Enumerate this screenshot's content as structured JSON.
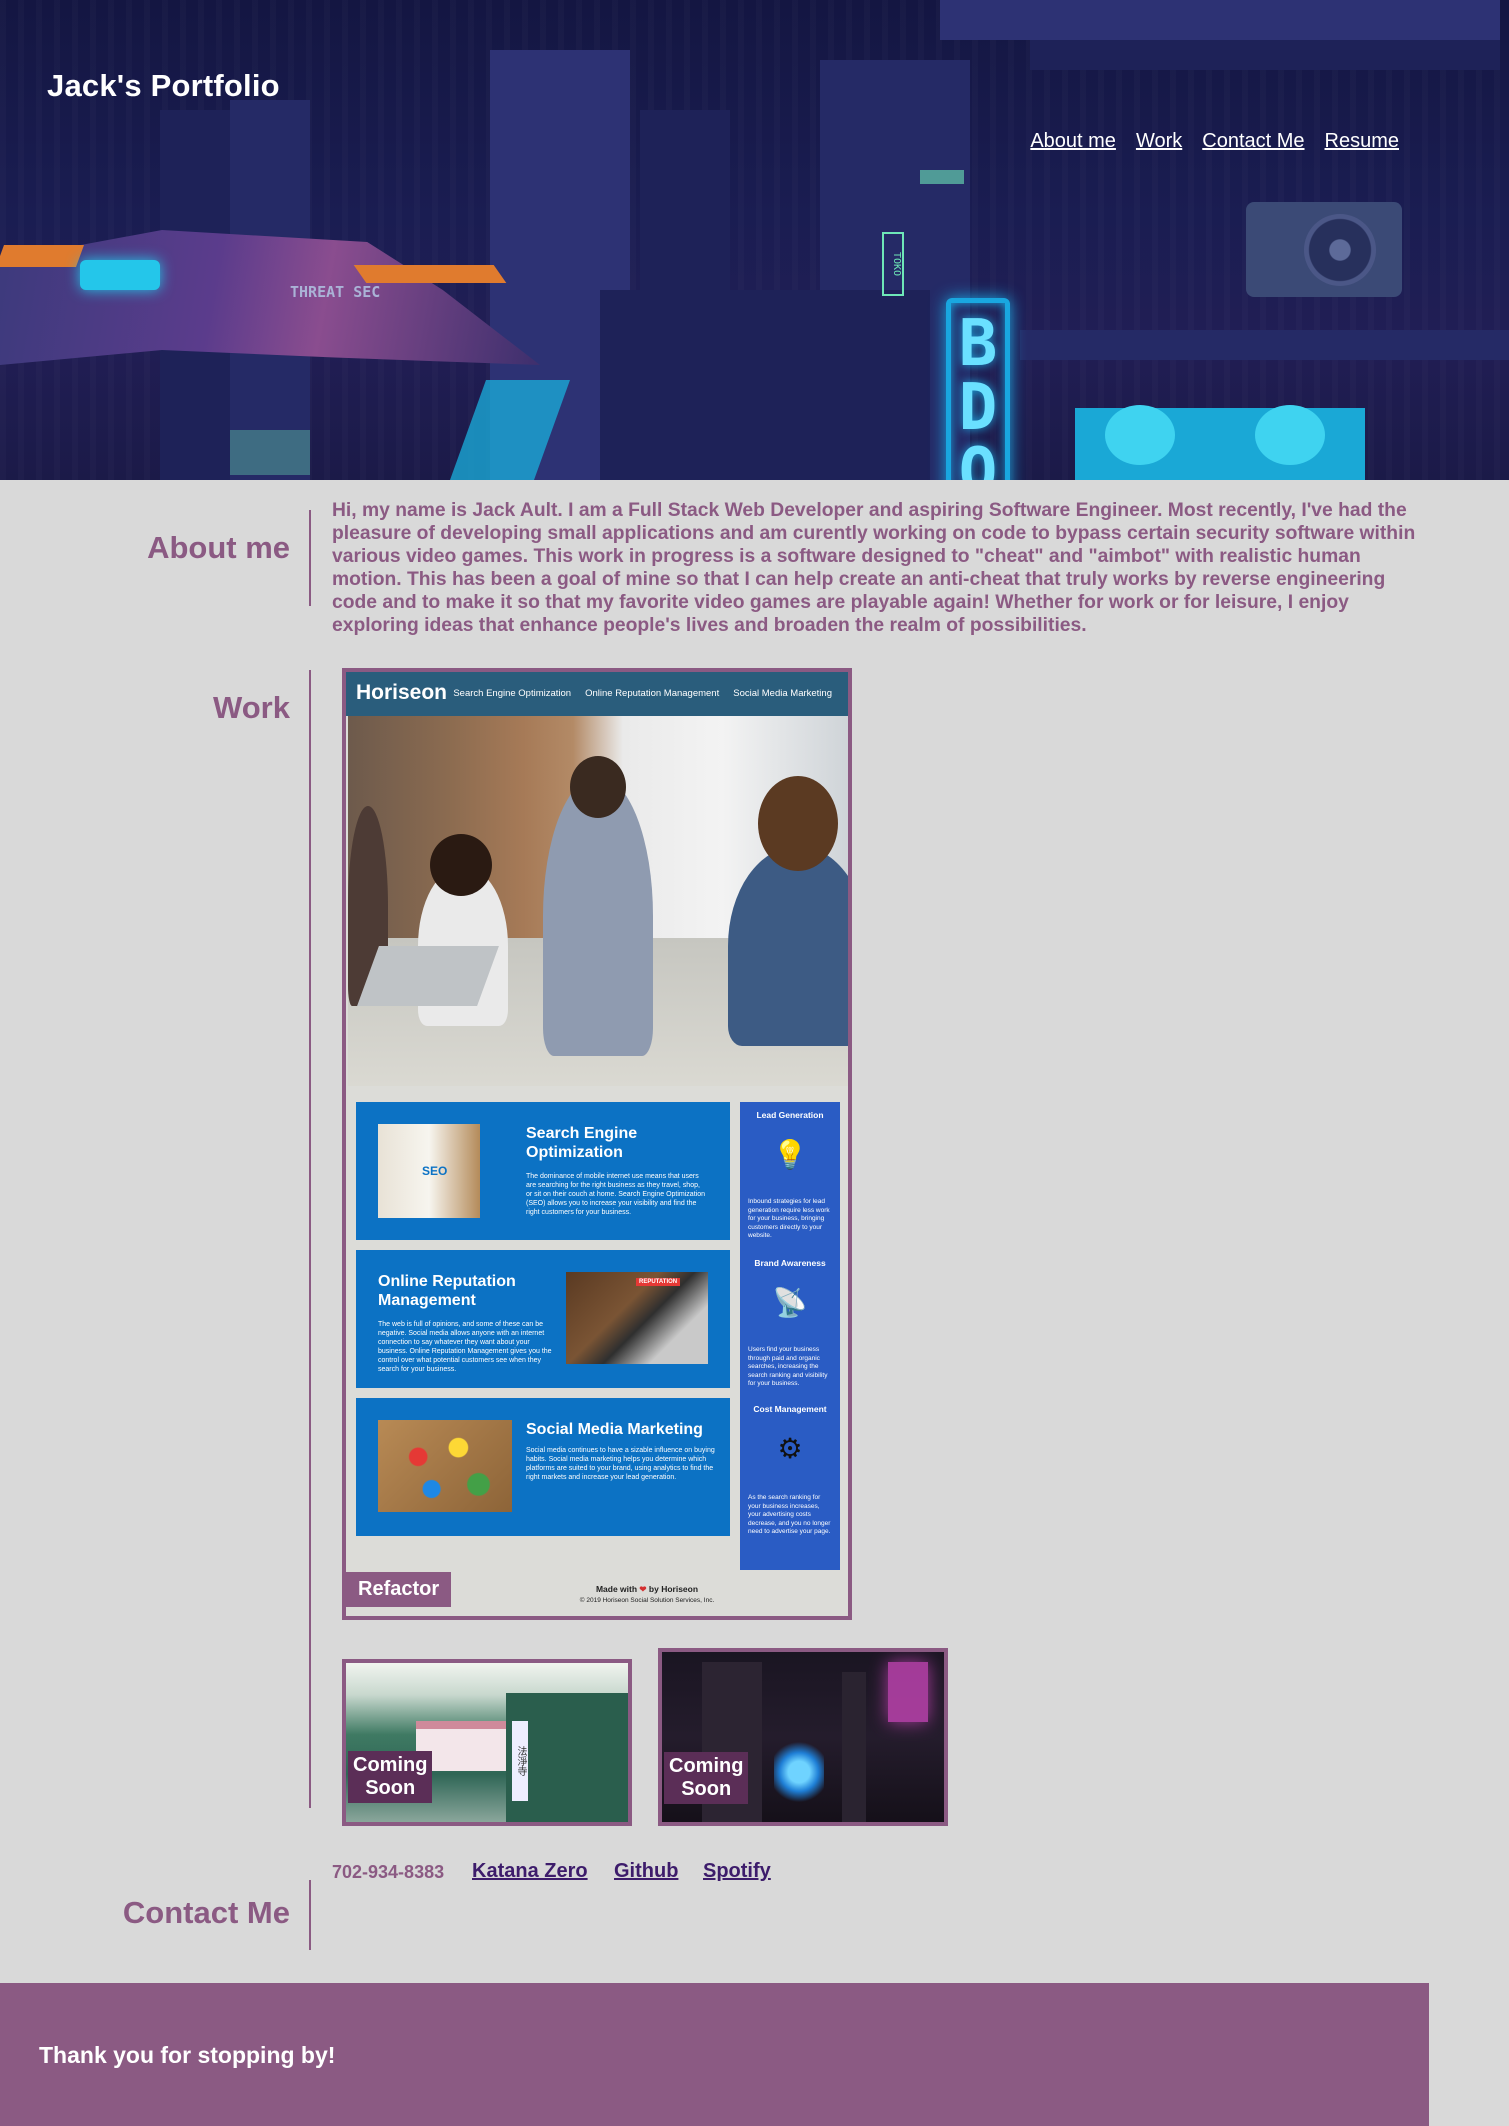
{
  "header": {
    "site_title": "Jack's Portfolio",
    "nav": [
      "About me",
      "Work",
      "Contact Me",
      "Resume"
    ],
    "hero_signs": {
      "vertical_neon": "BDO",
      "ship_text": "THREAT SEC",
      "small_sign": "TOKO"
    }
  },
  "about": {
    "heading": "About me",
    "text": "Hi, my name is Jack Ault. I am a Full Stack Web Developer and aspiring Software Engineer. Most recently, I've had the pleasure of developing small applications and am curently working on code to bypass certain security software within various video games. This work in progress is a software designed to \"cheat\" and \"aimbot\" with realistic human motion. This has been a goal of mine so that I can help create an anti-cheat that truly works by reverse engineering code and to make it so that my favorite video games are playable again! Whether for work or for leisure, I enjoy exploring ideas that enhance people's lives and broaden the realm of possibilities."
  },
  "work": {
    "heading": "Work",
    "featured": {
      "label": "Refactor",
      "screenshot": {
        "logo": "Horiseon",
        "nav": [
          "Search Engine Optimization",
          "Online Reputation Management",
          "Social Media Marketing"
        ],
        "cards": [
          {
            "title": "Search Engine Optimization",
            "text": "The dominance of mobile internet use means that users are searching for the right business as they travel, shop, or sit on their couch at home. Search Engine Optimization (SEO) allows you to increase your visibility and find the right customers for your business.",
            "image_icon": "seo-icon",
            "image_text": "SEO"
          },
          {
            "title": "Online Reputation Management",
            "text": "The web is full of opinions, and some of these can be negative. Social media allows anyone with an internet connection to say whatever they want about your business. Online Reputation Management gives you the control over what potential customers see when they search for your business.",
            "image_icon": "laptop-icon",
            "image_text": "REPUTATION"
          },
          {
            "title": "Social Media Marketing",
            "text": "Social media continues to have a sizable influence on buying habits. Social media marketing helps you determine which platforms are suited to your brand, using analytics to find the right markets and increase your lead generation.",
            "image_icon": "social-icon"
          }
        ],
        "benefits": [
          {
            "title": "Lead Generation",
            "text": "Inbound strategies for lead generation require less work for your business, bringing customers directly to your website.",
            "icon": "lightbulb-icon"
          },
          {
            "title": "Brand Awareness",
            "text": "Users find your business through paid and organic searches, increasing the search ranking and visibility for your business.",
            "icon": "broadcast-icon"
          },
          {
            "title": "Cost Management",
            "text": "As the search ranking for your business increases, your advertising costs decrease, and you no longer need to advertise your page.",
            "icon": "gears-icon"
          }
        ],
        "footer_line1": "Made with",
        "footer_heart": "❤",
        "footer_line1_end": "by Horiseon",
        "footer_line2": "© 2019 Horiseon Social Solution Services, Inc."
      }
    },
    "upcoming": [
      {
        "label_line1": "Coming",
        "label_line2": "Soon"
      },
      {
        "label_line1": "Coming",
        "label_line2": "Soon"
      }
    ],
    "upcoming_sign": "法淨寺"
  },
  "contact": {
    "heading": "Contact Me",
    "phone": "702-934-8383",
    "links": [
      "Katana Zero",
      "Github",
      "Spotify"
    ]
  },
  "footer": {
    "text": "Thank you for stopping by!"
  },
  "colors": {
    "accent": "#8b5a83",
    "background": "#d9d9d9",
    "link": "#3d1c6b",
    "horiseon_blue": "#0c72c4"
  }
}
